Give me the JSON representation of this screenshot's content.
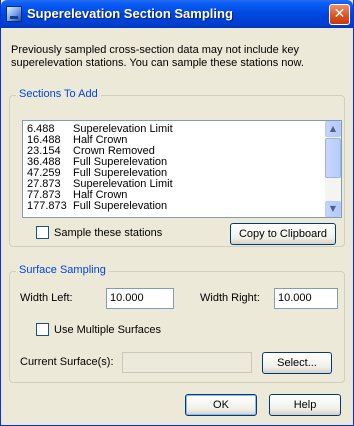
{
  "window": {
    "title": "Superelevation Section Sampling",
    "close_label": "✕"
  },
  "intro_text": "Previously sampled cross-section data may not include key\nsuperelevation stations.  You can sample these stations now.",
  "sections_to_add": {
    "legend": "Sections To Add",
    "stations": [
      {
        "station": "6.488",
        "name": "Superelevation Limit"
      },
      {
        "station": "16.488",
        "name": "Half Crown"
      },
      {
        "station": "23.154",
        "name": "Crown Removed"
      },
      {
        "station": "36.488",
        "name": "Full Superelevation"
      },
      {
        "station": "47.259",
        "name": "Full Superelevation"
      },
      {
        "station": "27.873",
        "name": "Superelevation Limit"
      },
      {
        "station": "77.873",
        "name": "Half Crown"
      },
      {
        "station": "177.873",
        "name": "Full Superelevation"
      }
    ],
    "sample_checkbox_label": "Sample these stations",
    "sample_checked": false,
    "copy_button_label": "Copy to Clipboard"
  },
  "surface_sampling": {
    "legend": "Surface Sampling",
    "width_left_label": "Width Left:",
    "width_left_value": "10.000",
    "width_right_label": "Width Right:",
    "width_right_value": "10.000",
    "multiple_surfaces_label": "Use Multiple Surfaces",
    "multiple_surfaces_checked": false,
    "current_surface_label": "Current Surface(s):",
    "current_surface_value": "",
    "select_button_label": "Select..."
  },
  "footer": {
    "ok_label": "OK",
    "help_label": "Help"
  },
  "colors": {
    "titlebar": "#0046e0",
    "legend_text": "#0046d5",
    "dialog_bg": "#ece9d8"
  },
  "icons": {
    "app": "app-icon",
    "close": "close-icon",
    "scroll_up": "scroll-up-arrow-icon",
    "scroll_down": "scroll-down-arrow-icon"
  }
}
